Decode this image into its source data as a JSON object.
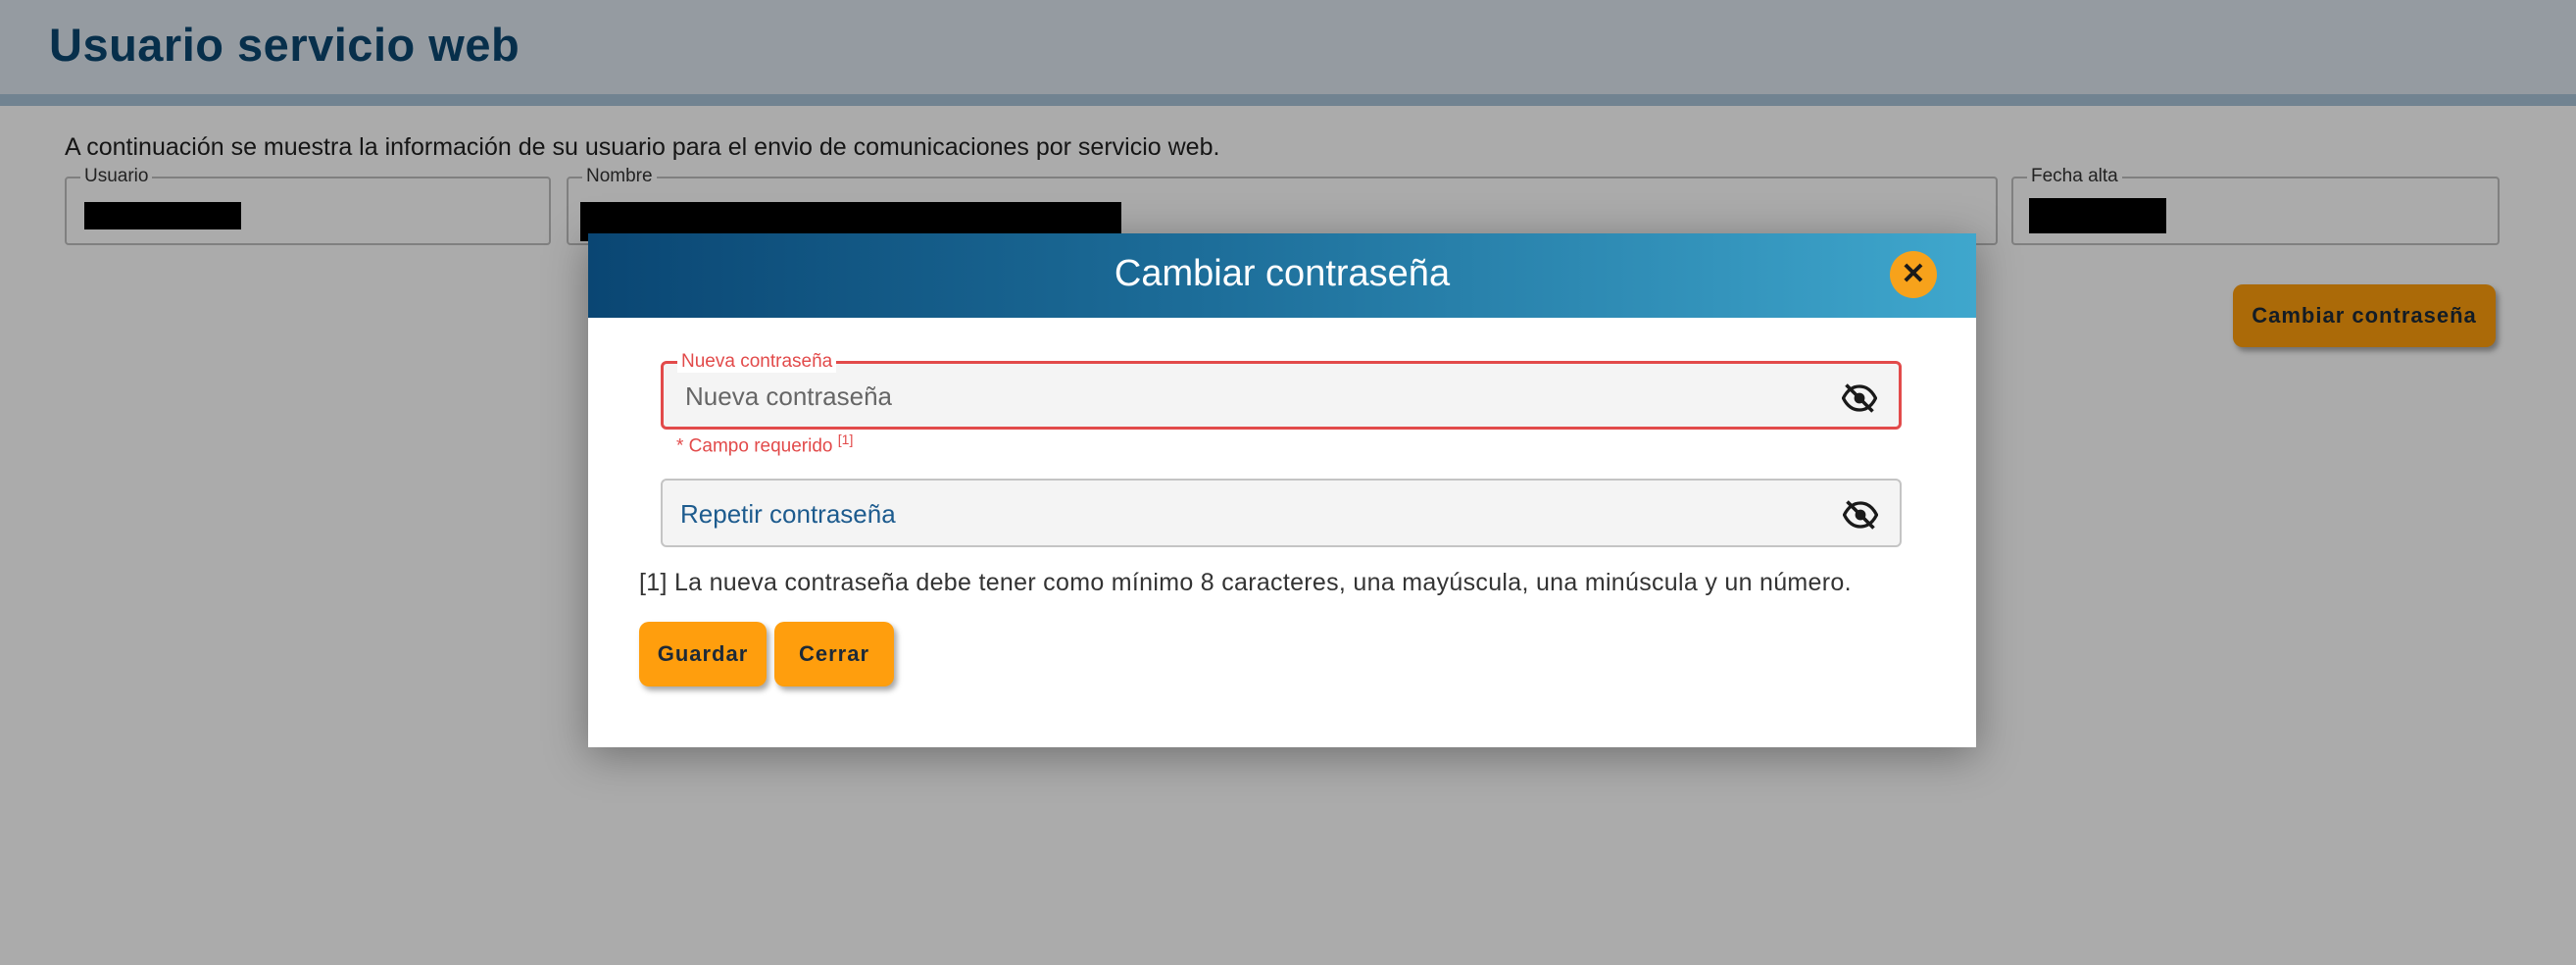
{
  "page": {
    "title": "Usuario servicio web",
    "intro": "A continuación se muestra la información de su usuario para el envio de comunicaciones por servicio web."
  },
  "fields": {
    "usuario_label": "Usuario",
    "nombre_label": "Nombre",
    "fecha_alta_label": "Fecha alta"
  },
  "actions": {
    "change_password_label": "Cambiar contraseña"
  },
  "modal": {
    "title": "Cambiar contraseña",
    "close_symbol": "✕",
    "new_password_label": "Nueva contraseña",
    "new_password_placeholder": "Nueva contraseña",
    "required_text": "* Campo requerido",
    "required_ref": "[1]",
    "repeat_password_placeholder": "Repetir contraseña",
    "hint": "[1] La nueva contraseña debe tener como mínimo 8 caracteres, una mayúscula, una minúscula y un número.",
    "save_label": "Guardar",
    "close_label": "Cerrar"
  },
  "icons": {
    "toggle_visibility": "eye-off-icon",
    "close": "close-icon"
  },
  "colors": {
    "header_title": "#0b4670",
    "button": "#ff9e0d",
    "error": "#e24a4a",
    "modal_header_start": "#0a4673",
    "modal_header_end": "#3fa7cd"
  }
}
